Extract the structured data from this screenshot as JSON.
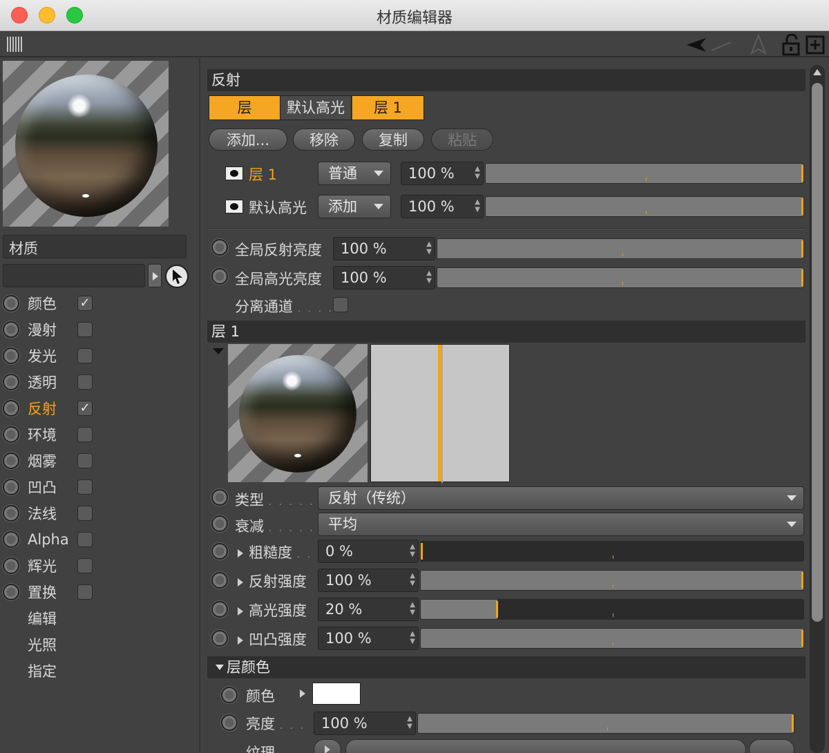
{
  "window": {
    "title": "材质编辑器"
  },
  "left": {
    "preview_label": "材质球预览",
    "name_label": "材质",
    "channels": [
      {
        "label": "颜色",
        "checked": true,
        "active": false
      },
      {
        "label": "漫射",
        "checked": false,
        "active": false
      },
      {
        "label": "发光",
        "checked": false,
        "active": false
      },
      {
        "label": "透明",
        "checked": false,
        "active": false
      },
      {
        "label": "反射",
        "checked": true,
        "active": true
      },
      {
        "label": "环境",
        "checked": false,
        "active": false
      },
      {
        "label": "烟雾",
        "checked": false,
        "active": false
      },
      {
        "label": "凹凸",
        "checked": false,
        "active": false
      },
      {
        "label": "法线",
        "checked": false,
        "active": false
      },
      {
        "label": "Alpha",
        "checked": false,
        "active": false
      },
      {
        "label": "辉光",
        "checked": false,
        "active": false
      },
      {
        "label": "置换",
        "checked": false,
        "active": false
      }
    ],
    "extras": [
      "编辑",
      "光照",
      "指定"
    ],
    "check_mark": "✓"
  },
  "reflect": {
    "title": "反射",
    "tabs": [
      "层",
      "默认高光",
      "层 1"
    ],
    "buttons": [
      "添加...",
      "移除",
      "复制",
      "粘贴"
    ],
    "layers": [
      {
        "name": "层 1",
        "mode": "普通",
        "value": "100 %",
        "highlight": true
      },
      {
        "name": "默认高光",
        "mode": "添加",
        "value": "100 %",
        "highlight": false
      }
    ],
    "global": [
      {
        "label": "全局反射亮度",
        "value": "100 %"
      },
      {
        "label": "全局高光亮度",
        "value": "100 %"
      }
    ],
    "separate_pass": "分离通道",
    "separate_dots": ". . . ."
  },
  "layer1": {
    "title": "层 1",
    "type_label": "类型",
    "type_value": "反射（传统）",
    "falloff_label": "衰减",
    "falloff_value": "平均",
    "dots": ". . . . .",
    "params": [
      {
        "label": "粗糙度",
        "suffix": ". .",
        "value": "0 %",
        "pct": 0
      },
      {
        "label": "反射强度",
        "suffix": "",
        "value": "100 %",
        "pct": 1
      },
      {
        "label": "高光强度",
        "suffix": "",
        "value": "20 %",
        "pct": 0.2
      },
      {
        "label": "凹凸强度",
        "suffix": "",
        "value": "100 %",
        "pct": 1
      }
    ]
  },
  "layer_color": {
    "title": "层颜色",
    "color_label": "颜色",
    "brightness_label": "亮度",
    "brightness_dots": ". . .",
    "brightness_value": "100 %",
    "texture_label": "纹理",
    "swatch": "#ffffff"
  },
  "colors": {
    "accent": "#f3a418",
    "tab_active": "#f5a623"
  }
}
